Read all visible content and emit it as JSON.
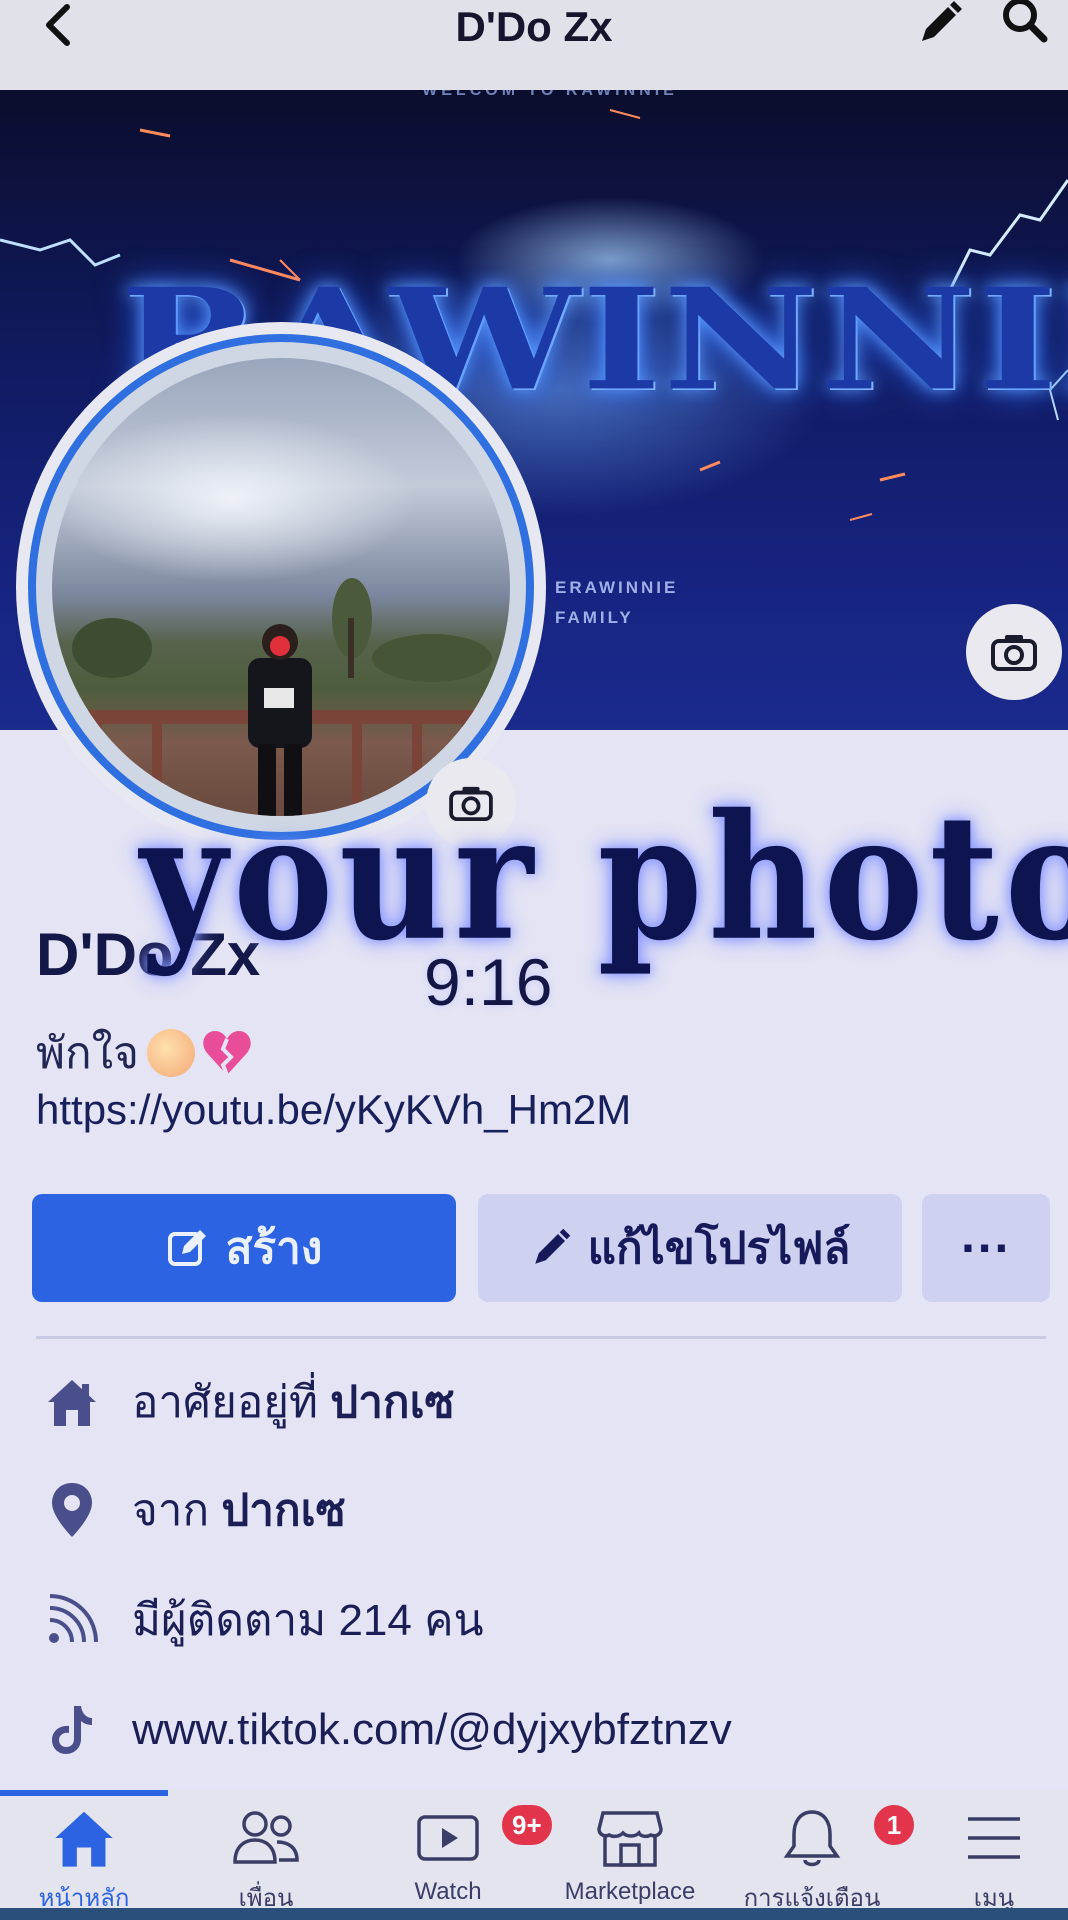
{
  "header": {
    "title": "D'Do Zx",
    "back_icon": "chevron-left-icon",
    "edit_icon": "pencil-icon",
    "search_icon": "search-icon"
  },
  "cover": {
    "welcome_text": "WELCOM TO RAWINNIE",
    "brand_text": "RAWINNIE",
    "tag_line_1": "ERAWINNIE",
    "tag_line_2": "FAMILY"
  },
  "overlay": {
    "watermark": "your photo",
    "timecode": "9:16"
  },
  "profile": {
    "name": "D'Do Zx",
    "bio": "พักใจ",
    "link": "https://youtu.be/yKyKVh_Hm2M"
  },
  "actions": {
    "create_label": "สร้าง",
    "edit_label": "แก้ไขโปรไฟล์",
    "more_label": "···"
  },
  "details": [
    {
      "icon": "home-icon",
      "prefix": "อาศัยอยู่ที่",
      "value": "ปากเซ"
    },
    {
      "icon": "location-pin-icon",
      "prefix": "จาก",
      "value": "ปากเซ"
    },
    {
      "icon": "rss-followers-icon",
      "prefix": "มีผู้ติดตาม 214 คน",
      "value": ""
    },
    {
      "icon": "tiktok-icon",
      "prefix": "www.tiktok.com/@dyjxybfztnzv",
      "value": ""
    }
  ],
  "nav": {
    "items": [
      {
        "label": "หน้าหลัก",
        "icon": "home-icon",
        "active": true
      },
      {
        "label": "เพื่อน",
        "icon": "friends-icon"
      },
      {
        "label": "Watch",
        "icon": "watch-icon",
        "badge": "9+"
      },
      {
        "label": "Marketplace",
        "icon": "marketplace-icon"
      },
      {
        "label": "การแจ้งเตือน",
        "icon": "bell-icon",
        "badge": "1"
      },
      {
        "label": "เมนู",
        "icon": "menu-icon"
      }
    ]
  },
  "colors": {
    "accent": "#2c63e3",
    "badge": "#e2344a",
    "background": "#e4e4f4"
  }
}
